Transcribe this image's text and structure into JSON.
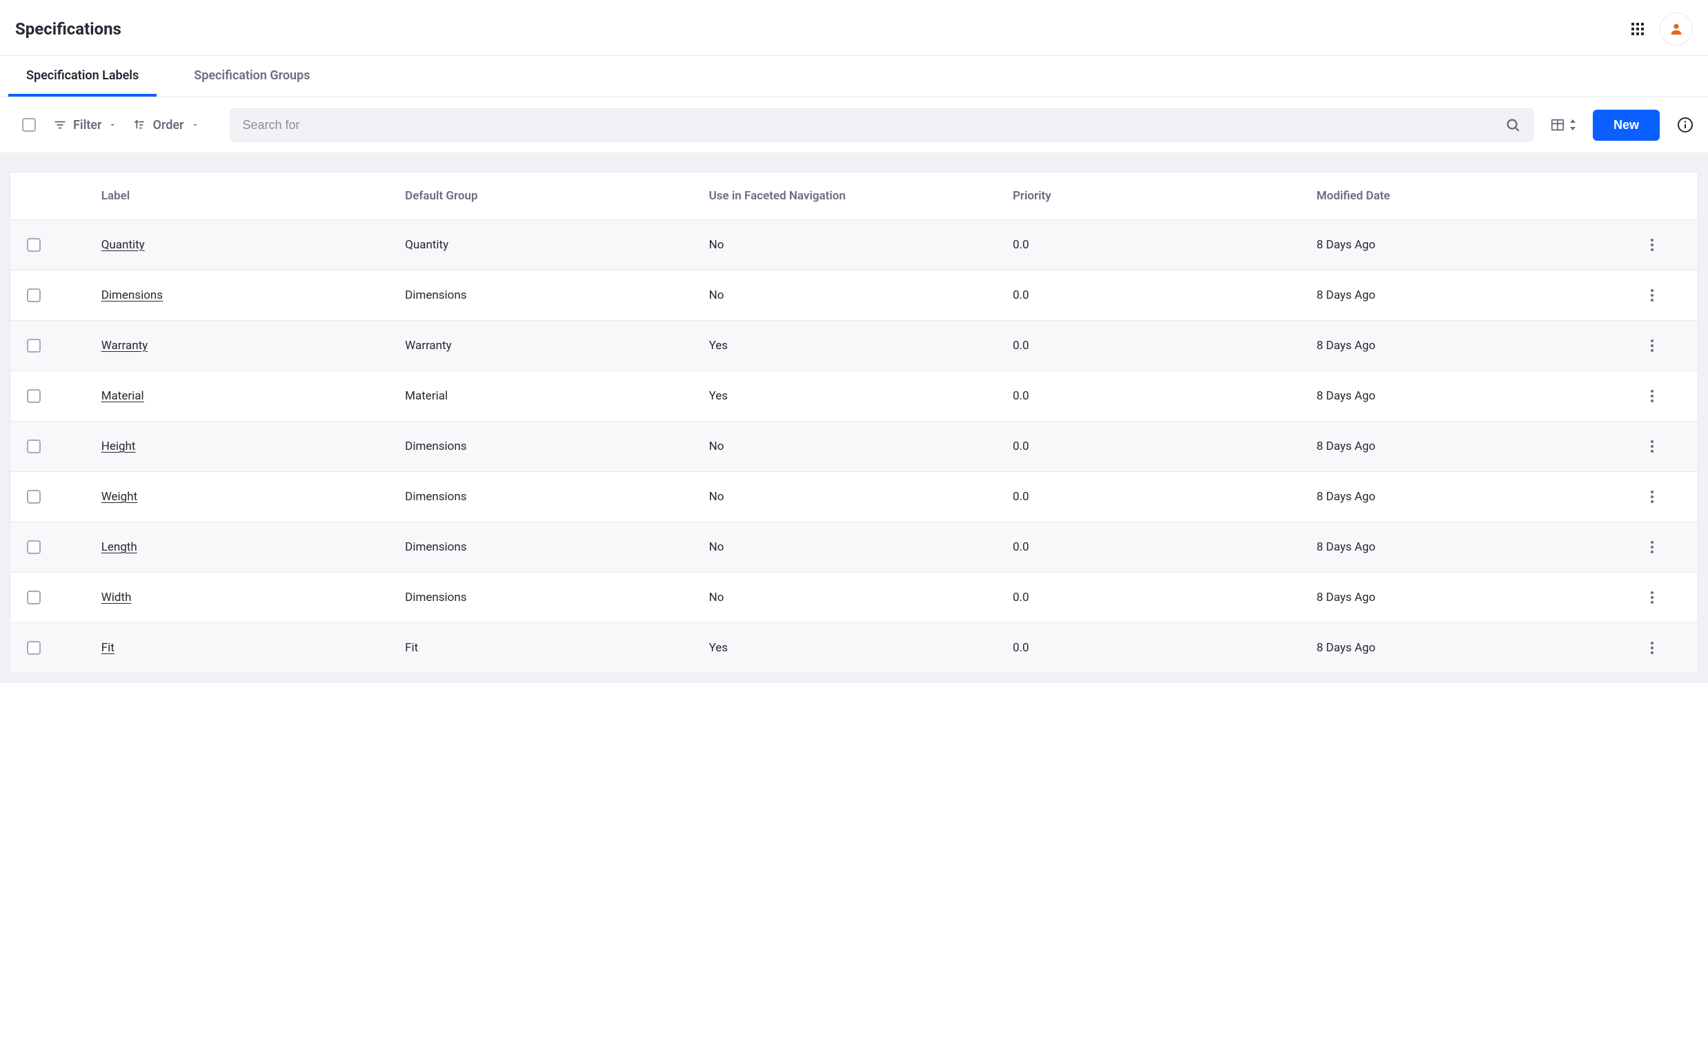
{
  "header": {
    "title": "Specifications"
  },
  "tabs": [
    {
      "label": "Specification Labels",
      "active": true
    },
    {
      "label": "Specification Groups",
      "active": false
    }
  ],
  "toolbar": {
    "filter_label": "Filter",
    "order_label": "Order",
    "search_placeholder": "Search for",
    "new_button_label": "New"
  },
  "table": {
    "columns": {
      "label": "Label",
      "default_group": "Default Group",
      "faceted": "Use in Faceted Navigation",
      "priority": "Priority",
      "modified": "Modified Date"
    },
    "rows": [
      {
        "label": "Quantity",
        "group": "Quantity",
        "faceted": "No",
        "priority": "0.0",
        "modified": "8 Days Ago"
      },
      {
        "label": "Dimensions",
        "group": "Dimensions",
        "faceted": "No",
        "priority": "0.0",
        "modified": "8 Days Ago"
      },
      {
        "label": "Warranty",
        "group": "Warranty",
        "faceted": "Yes",
        "priority": "0.0",
        "modified": "8 Days Ago"
      },
      {
        "label": "Material",
        "group": "Material",
        "faceted": "Yes",
        "priority": "0.0",
        "modified": "8 Days Ago"
      },
      {
        "label": "Height",
        "group": "Dimensions",
        "faceted": "No",
        "priority": "0.0",
        "modified": "8 Days Ago"
      },
      {
        "label": "Weight",
        "group": "Dimensions",
        "faceted": "No",
        "priority": "0.0",
        "modified": "8 Days Ago"
      },
      {
        "label": "Length",
        "group": "Dimensions",
        "faceted": "No",
        "priority": "0.0",
        "modified": "8 Days Ago"
      },
      {
        "label": "Width",
        "group": "Dimensions",
        "faceted": "No",
        "priority": "0.0",
        "modified": "8 Days Ago"
      },
      {
        "label": "Fit",
        "group": "Fit",
        "faceted": "Yes",
        "priority": "0.0",
        "modified": "8 Days Ago"
      }
    ]
  }
}
